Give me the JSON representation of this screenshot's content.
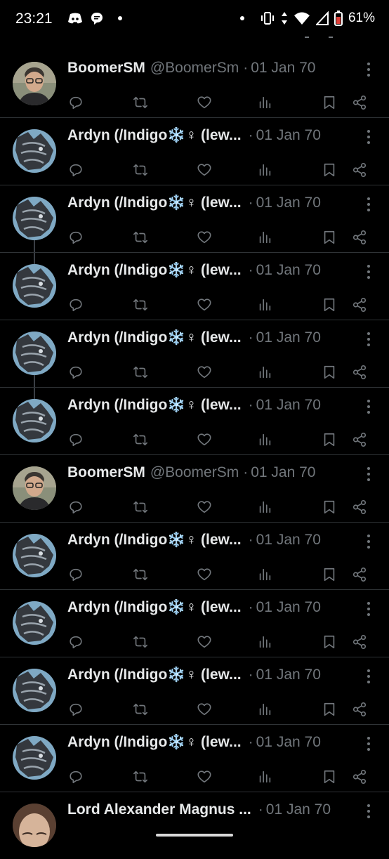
{
  "status_bar": {
    "time": "23:21",
    "battery": "61%",
    "icons_left": [
      "discord-icon",
      "chat-bubble-icon",
      "dot-icon"
    ],
    "icons_right": [
      "dot-icon",
      "vibrate-icon",
      "data-arrows-icon",
      "wifi-icon",
      "signal-icon",
      "battery-icon"
    ]
  },
  "tweets": [
    {
      "name": "BoomerSM",
      "handle": "@BoomerSm",
      "date": "01 Jan 70",
      "avatar": "person",
      "thread_top": false,
      "thread_bottom": false
    },
    {
      "name": "Ardyn (/Indigo❄️♀ (lew...",
      "handle": "",
      "date": "01 Jan 70",
      "avatar": "ardyn",
      "thread_top": false,
      "thread_bottom": false
    },
    {
      "name": "Ardyn (/Indigo❄️♀ (lew...",
      "handle": "",
      "date": "01 Jan 70",
      "avatar": "ardyn",
      "thread_top": false,
      "thread_bottom": true
    },
    {
      "name": "Ardyn (/Indigo❄️♀ (lew...",
      "handle": "",
      "date": "01 Jan 70",
      "avatar": "ardyn",
      "thread_top": true,
      "thread_bottom": false
    },
    {
      "name": "Ardyn (/Indigo❄️♀ (lew...",
      "handle": "",
      "date": "01 Jan 70",
      "avatar": "ardyn",
      "thread_top": false,
      "thread_bottom": true
    },
    {
      "name": "Ardyn (/Indigo❄️♀ (lew...",
      "handle": "",
      "date": "01 Jan 70",
      "avatar": "ardyn",
      "thread_top": true,
      "thread_bottom": false
    },
    {
      "name": "BoomerSM",
      "handle": "@BoomerSm",
      "date": "01 Jan 70",
      "avatar": "person",
      "thread_top": false,
      "thread_bottom": false
    },
    {
      "name": "Ardyn (/Indigo❄️♀ (lew...",
      "handle": "",
      "date": "01 Jan 70",
      "avatar": "ardyn",
      "thread_top": false,
      "thread_bottom": false
    },
    {
      "name": "Ardyn (/Indigo❄️♀ (lew...",
      "handle": "",
      "date": "01 Jan 70",
      "avatar": "ardyn",
      "thread_top": false,
      "thread_bottom": false
    },
    {
      "name": "Ardyn (/Indigo❄️♀ (lew...",
      "handle": "",
      "date": "01 Jan 70",
      "avatar": "ardyn",
      "thread_top": false,
      "thread_bottom": false
    },
    {
      "name": "Ardyn (/Indigo❄️♀ (lew...",
      "handle": "",
      "date": "01 Jan 70",
      "avatar": "ardyn",
      "thread_top": false,
      "thread_bottom": false
    },
    {
      "name": "Lord Alexander Magnus ...",
      "handle": "",
      "date": "01 Jan 70",
      "avatar": "lord",
      "thread_top": false,
      "thread_bottom": false
    }
  ],
  "colors": {
    "background": "#000000",
    "divider": "#2f3336",
    "text": "#e7e9ea",
    "muted": "#71767b"
  }
}
